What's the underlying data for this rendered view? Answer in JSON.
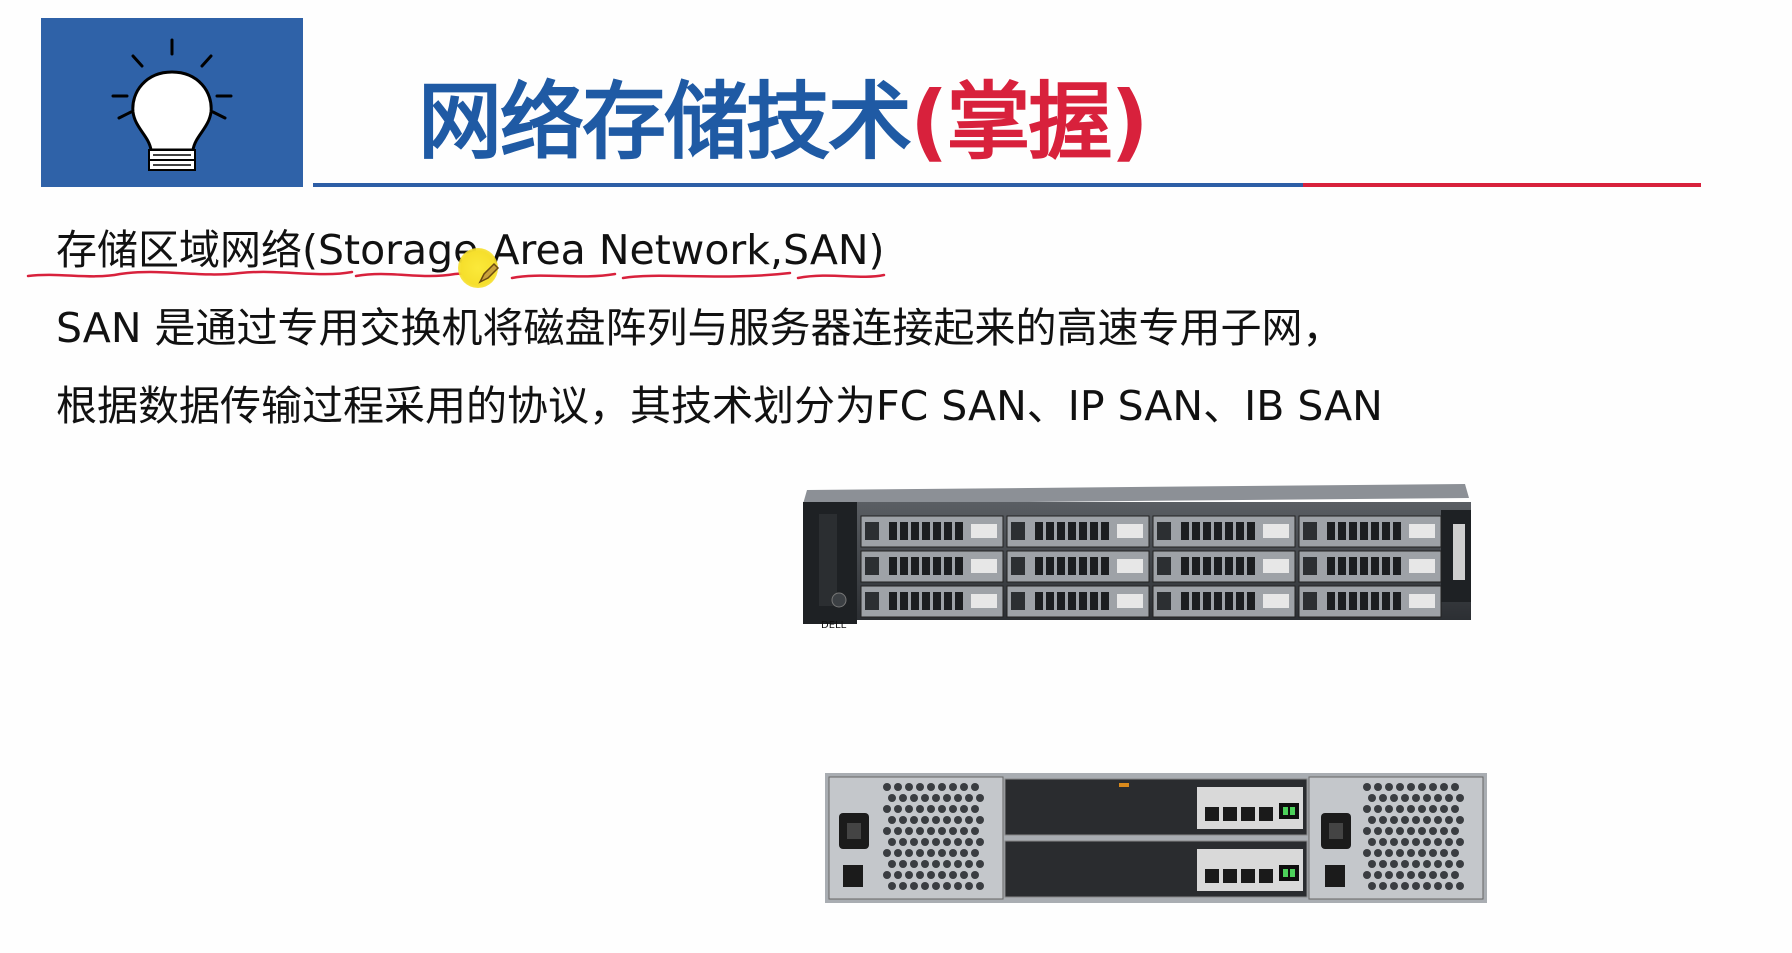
{
  "slide": {
    "title_main": "网络存储技术",
    "title_accent": "(掌握)",
    "line1": "存储区域网络(Storage Area Network,SAN)",
    "line2": "SAN 是通过专用交换机将磁盘阵列与服务器连接起来的高速专用子网，",
    "line3": "根据数据传输过程采用的协议，其技术划分为FC SAN、IP SAN、IB SAN"
  },
  "icons": {
    "logo": "lightbulb-icon",
    "cursor": "laser-pointer-icon"
  },
  "colors": {
    "logo_bg": "#2f62a8",
    "title_blue": "#1f5aa4",
    "title_red": "#d8213c",
    "annotation_red": "#d8213c",
    "pointer_yellow": "#f6df2c"
  },
  "device_front": {
    "brand": "DELL"
  }
}
